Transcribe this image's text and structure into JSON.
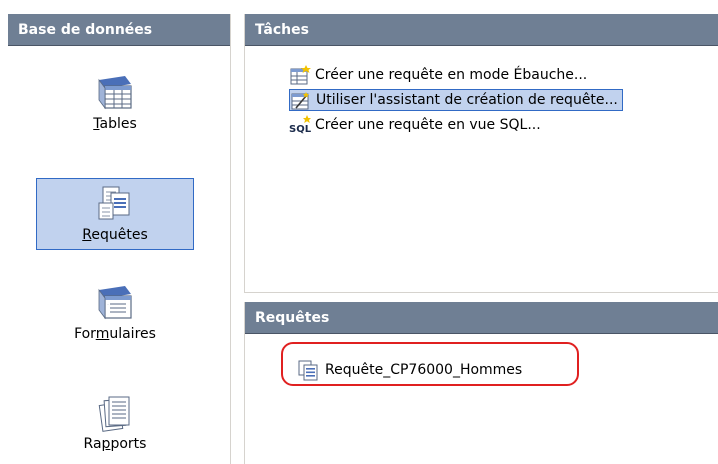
{
  "database_panel": {
    "title": "Base de données",
    "items": [
      {
        "label_pre": "",
        "label_underline": "T",
        "label_post": "ables",
        "icon": "tables-icon",
        "selected": false
      },
      {
        "label_pre": "",
        "label_underline": "R",
        "label_post": "equêtes",
        "icon": "queries-icon",
        "selected": true
      },
      {
        "label_pre": "For",
        "label_underline": "m",
        "label_post": "ulaires",
        "icon": "forms-icon",
        "selected": false
      },
      {
        "label_pre": "Ra",
        "label_underline": "p",
        "label_post": "ports",
        "icon": "reports-icon",
        "selected": false
      }
    ]
  },
  "tasks_panel": {
    "title": "Tâches",
    "tasks": [
      {
        "label": "Créer une requête en mode Ébauche...",
        "icon": "design-query-icon",
        "hover": false
      },
      {
        "label": "Utiliser l'assistant de création de requête...",
        "icon": "wizard-query-icon",
        "hover": true
      },
      {
        "label": "Créer une requête en vue SQL...",
        "icon": "sql-query-icon",
        "hover": false
      }
    ]
  },
  "queries_panel": {
    "title": "Requêtes",
    "items": [
      {
        "label": "Requête_CP76000_Hommes",
        "icon": "query-icon"
      }
    ]
  },
  "colors": {
    "header_bg": "#6f7f94",
    "selection_bg": "#c1d2ee",
    "selection_border": "#316ac5",
    "highlight_ring": "#e02020"
  }
}
